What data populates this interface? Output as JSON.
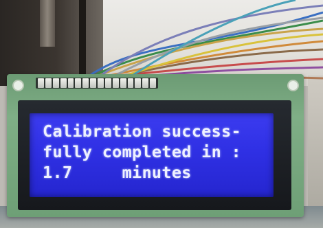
{
  "lcd": {
    "lines": [
      "Calibration success-",
      "fully completed in :",
      "1.7     minutes"
    ],
    "colors": {
      "backlight": "#3131e6",
      "characters": "#eef1ff",
      "pcb": "#7aa982"
    }
  }
}
